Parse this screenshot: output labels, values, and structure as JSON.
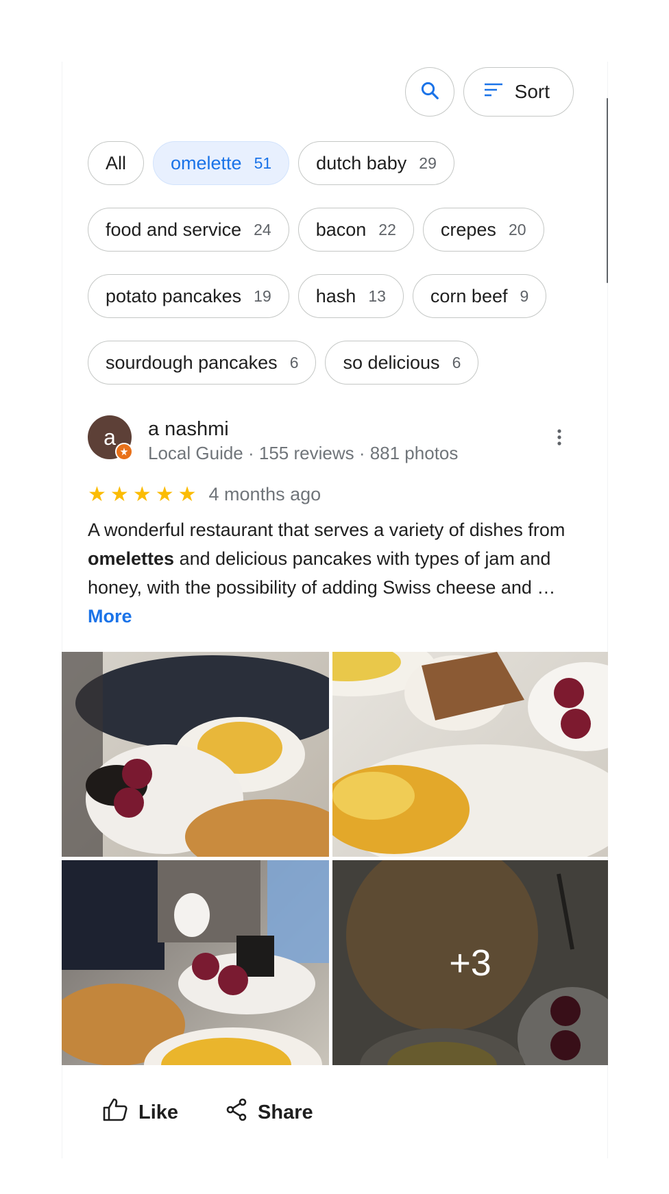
{
  "toolbar": {
    "sort_label": "Sort"
  },
  "chips": [
    [
      {
        "label": "All",
        "count": ""
      },
      {
        "label": "omelette",
        "count": "51",
        "selected": true
      },
      {
        "label": "dutch baby",
        "count": "29"
      }
    ],
    [
      {
        "label": "food and service",
        "count": "24"
      },
      {
        "label": "bacon",
        "count": "22"
      },
      {
        "label": "crepes",
        "count": "20"
      }
    ],
    [
      {
        "label": "potato pancakes",
        "count": "19"
      },
      {
        "label": "hash",
        "count": "13"
      },
      {
        "label": "corn beef",
        "count": "9"
      }
    ],
    [
      {
        "label": "sourdough pancakes",
        "count": "6"
      },
      {
        "label": "so delicious",
        "count": "6"
      }
    ]
  ],
  "review": {
    "avatar_letter": "a",
    "name": "a nashmi",
    "meta": "Local Guide · 155 reviews · 881 photos",
    "rating": 5,
    "time": "4 months ago",
    "text_before": "A wonderful restaurant that serves a variety of dishes from ",
    "text_bold": "omelettes",
    "text_after": " and delicious pancakes with types of jam and honey, with the possibility of adding Swiss cheese and … ",
    "more_label": "More",
    "extra_photos": "+3"
  },
  "actions": {
    "like_label": "Like",
    "share_label": "Share"
  },
  "colors": {
    "accent": "#1a73e8",
    "star": "#fbbc04",
    "avatar_bg": "#5d4037",
    "guide_badge": "#e8711a"
  }
}
